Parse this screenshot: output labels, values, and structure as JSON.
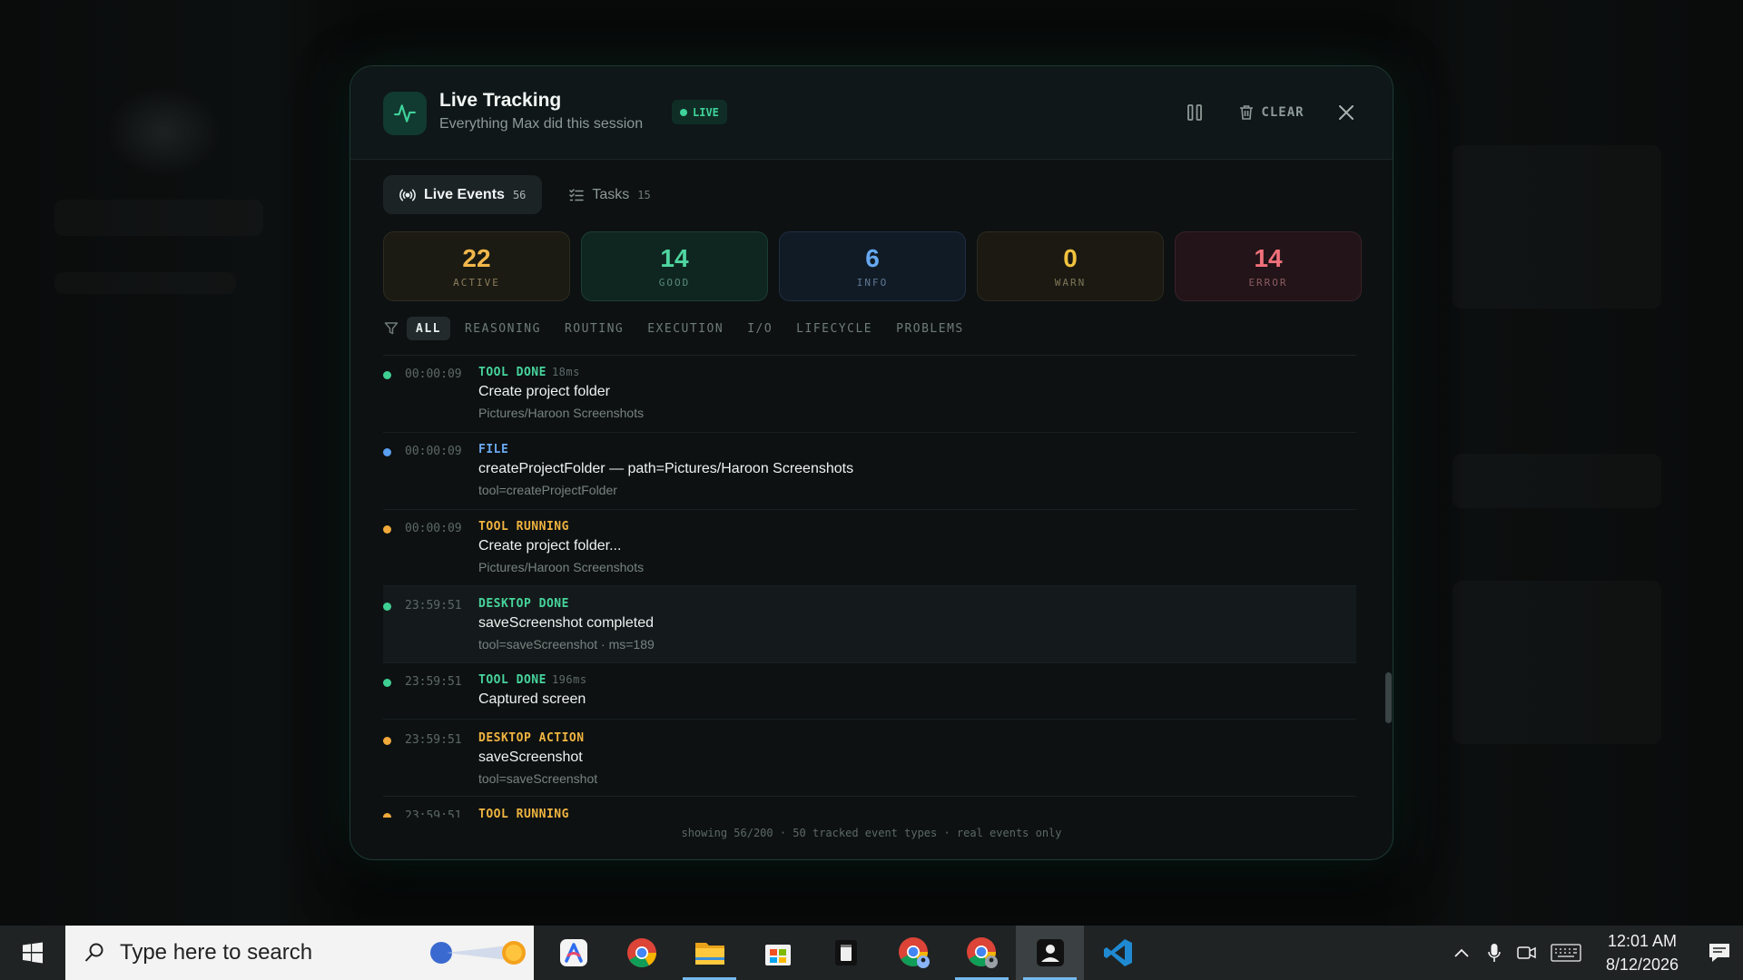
{
  "modal": {
    "title": "Live Tracking",
    "subtitle": "Everything Max did this session",
    "live_badge": "LIVE",
    "clear_label": "CLEAR"
  },
  "tabs": [
    {
      "label": "Live Events",
      "count": "56",
      "active": true
    },
    {
      "label": "Tasks",
      "count": "15",
      "active": false
    }
  ],
  "stats": [
    {
      "value": "22",
      "label": "ACTIVE",
      "color": "#f2b84b"
    },
    {
      "value": "14",
      "label": "GOOD",
      "color": "#4fd6a0"
    },
    {
      "value": "6",
      "label": "INFO",
      "color": "#66a8f0"
    },
    {
      "value": "0",
      "label": "WARN",
      "color": "#f2c23e"
    },
    {
      "value": "14",
      "label": "ERROR",
      "color": "#f0707a"
    }
  ],
  "filters": [
    "ALL",
    "REASONING",
    "ROUTING",
    "EXECUTION",
    "I/O",
    "LIFECYCLE",
    "PROBLEMS"
  ],
  "events": [
    {
      "time": "00:00:09",
      "type": "TOOL DONE",
      "duration": "18ms",
      "title": "Create project folder",
      "meta": "Pictures/Haroon Screenshots",
      "status": "green"
    },
    {
      "time": "00:00:09",
      "type": "FILE",
      "duration": "",
      "title": "createProjectFolder — path=Pictures/Haroon Screenshots",
      "meta": "tool=createProjectFolder",
      "status": "blue"
    },
    {
      "time": "00:00:09",
      "type": "TOOL RUNNING",
      "duration": "",
      "title": "Create project folder...",
      "meta": "Pictures/Haroon Screenshots",
      "status": "amber"
    },
    {
      "time": "23:59:51",
      "type": "DESKTOP DONE",
      "duration": "",
      "title": "saveScreenshot completed",
      "meta": "tool=saveScreenshot · ms=189",
      "status": "green"
    },
    {
      "time": "23:59:51",
      "type": "TOOL DONE",
      "duration": "196ms",
      "title": "Captured screen",
      "meta": "",
      "status": "green"
    },
    {
      "time": "23:59:51",
      "type": "DESKTOP ACTION",
      "duration": "",
      "title": "saveScreenshot",
      "meta": "tool=saveScreenshot",
      "status": "amber"
    },
    {
      "time": "23:59:51",
      "type": "TOOL RUNNING",
      "duration": "",
      "title": "",
      "meta": "",
      "status": "amber"
    }
  ],
  "footer_note": "showing 56/200 · 50 tracked event types · real events only",
  "taskbar": {
    "search_placeholder": "Type here to search",
    "time": "12:01 AM",
    "date": "8/12/2026"
  },
  "colors": {
    "accent": "#3fd39b",
    "green": "#47d39c",
    "blue": "#6aa9f2",
    "amber": "#f0b440"
  }
}
